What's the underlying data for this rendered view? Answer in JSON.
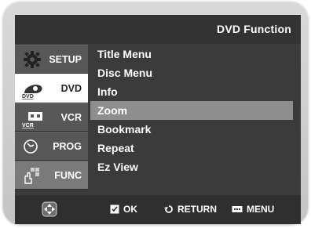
{
  "header": {
    "title": "DVD Function"
  },
  "sidebar": {
    "items": [
      {
        "label": "SETUP",
        "icon": "gear-icon"
      },
      {
        "label": "DVD",
        "icon": "dvd-disc-icon",
        "icon_text": "DVD"
      },
      {
        "label": "VCR",
        "icon": "vcr-icon",
        "icon_text": "VCR"
      },
      {
        "label": "PROG",
        "icon": "clock-icon"
      },
      {
        "label": "FUNC",
        "icon": "func-hand-icon"
      }
    ]
  },
  "menu": {
    "items": [
      {
        "label": "Title Menu"
      },
      {
        "label": "Disc Menu"
      },
      {
        "label": "Info"
      },
      {
        "label": "Zoom"
      },
      {
        "label": "Bookmark"
      },
      {
        "label": "Repeat"
      },
      {
        "label": "Ez View"
      }
    ],
    "highlighted_index": 3
  },
  "footer": {
    "ok_label": "OK",
    "return_label": "RETURN",
    "menu_label": "MENU"
  },
  "colors": {
    "frame": "#c8c8c8",
    "screen": "#3b3b3b",
    "highlight": "#8e8e8e"
  }
}
